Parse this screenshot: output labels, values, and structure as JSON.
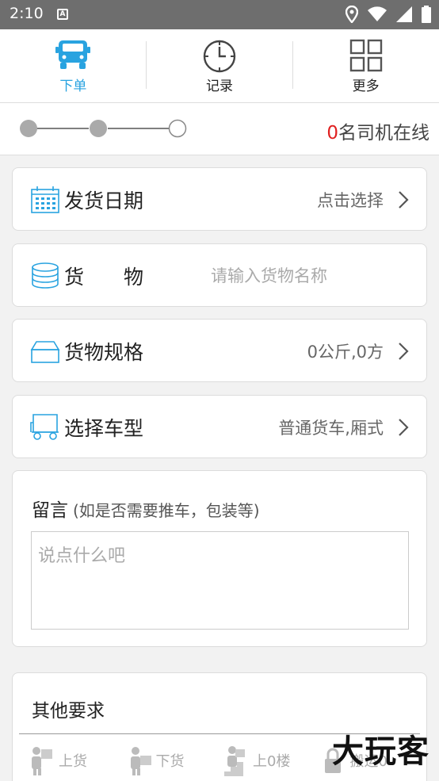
{
  "status_bar": {
    "time": "2:10"
  },
  "nav": {
    "tabs": [
      {
        "label": "下单",
        "icon": "truck-icon",
        "active": true
      },
      {
        "label": "记录",
        "icon": "clock-icon",
        "active": false
      },
      {
        "label": "更多",
        "icon": "grid-icon",
        "active": false
      }
    ]
  },
  "progress": {
    "online_count": "0",
    "online_text": "名司机在线"
  },
  "form": {
    "ship_date": {
      "label": "发货日期",
      "value": "点击选择"
    },
    "goods": {
      "label": "货　　物",
      "placeholder": "请输入货物名称"
    },
    "spec": {
      "label": "货物规格",
      "value": "0公斤,0方"
    },
    "vehicle": {
      "label": "选择车型",
      "value": "普通货车,厢式"
    }
  },
  "message": {
    "title": "留言",
    "hint": "(如是否需要推车，包装等)",
    "placeholder": "说点什么吧"
  },
  "other": {
    "title": "其他要求",
    "options": [
      {
        "label": "上货"
      },
      {
        "label": "下货"
      },
      {
        "label": "上0楼"
      },
      {
        "label": "搬运0"
      }
    ]
  },
  "watermark": "大玩客",
  "colors": {
    "accent": "#29a3e0",
    "highlight": "#e02020"
  }
}
